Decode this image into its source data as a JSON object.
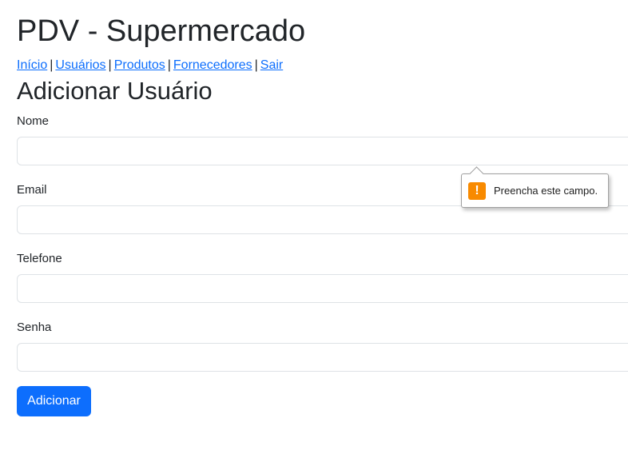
{
  "header": {
    "app_title": "PDV - Supermercado"
  },
  "nav": {
    "items": [
      {
        "label": "Início"
      },
      {
        "label": "Usuários"
      },
      {
        "label": "Produtos"
      },
      {
        "label": "Fornecedores"
      },
      {
        "label": "Sair"
      }
    ],
    "separator": "|"
  },
  "form": {
    "heading": "Adicionar Usuário",
    "fields": [
      {
        "label": "Nome",
        "value": "",
        "placeholder": ""
      },
      {
        "label": "Email",
        "value": "",
        "placeholder": ""
      },
      {
        "label": "Telefone",
        "value": "",
        "placeholder": ""
      },
      {
        "label": "Senha",
        "value": "",
        "placeholder": ""
      }
    ],
    "submit_label": "Adicionar"
  },
  "validation_tooltip": {
    "icon": "warning-icon",
    "icon_glyph": "!",
    "icon_color": "#f88a00",
    "message": "Preencha este campo."
  },
  "colors": {
    "primary": "#0d6efd",
    "text": "#212529",
    "border": "#dee2e6"
  }
}
